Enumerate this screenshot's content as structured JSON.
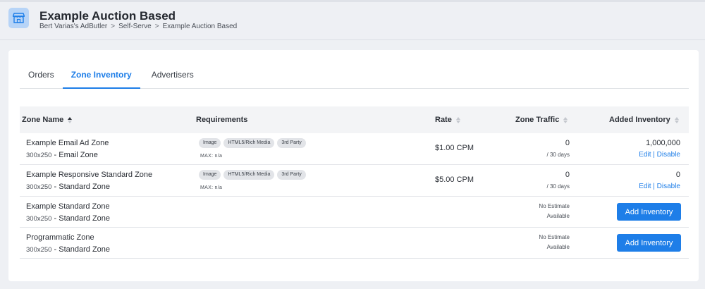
{
  "header": {
    "title": "Example Auction Based",
    "breadcrumb": [
      "Bert Varias's AdButler",
      "Self-Serve",
      "Example Auction Based"
    ],
    "breadcrumb_sep": ">"
  },
  "tabs": [
    {
      "label": "Orders",
      "active": false
    },
    {
      "label": "Zone Inventory",
      "active": true
    },
    {
      "label": "Advertisers",
      "active": false
    }
  ],
  "table": {
    "columns": [
      "Zone Name",
      "Requirements",
      "Rate",
      "Zone Traffic",
      "Added Inventory"
    ],
    "rows": [
      {
        "name": "Example Email Ad Zone",
        "size": "300x250",
        "type": "Email Zone",
        "badges": [
          "Image",
          "HTML5/Rich Media",
          "3rd Party"
        ],
        "max": "MAX: n/a",
        "rate": "$1.00 CPM",
        "traffic": "0",
        "traffic_period": "/ 30 days",
        "added": "1,000,000",
        "edit": "Edit",
        "pipe": "|",
        "disable": "Disable"
      },
      {
        "name": "Example Responsive Standard Zone",
        "size": "300x250",
        "type": "Standard Zone",
        "badges": [
          "Image",
          "HTML5/Rich Media",
          "3rd Party"
        ],
        "max": "MAX: n/a",
        "rate": "$5.00 CPM",
        "traffic": "0",
        "traffic_period": "/ 30 days",
        "added": "0",
        "edit": "Edit",
        "pipe": "|",
        "disable": "Disable"
      },
      {
        "name": "Example Standard Zone",
        "size": "300x250",
        "type": "Standard Zone",
        "estimate": [
          "No Estimate",
          "Available"
        ],
        "button": "Add Inventory"
      },
      {
        "name": "Programmatic Zone",
        "size": "300x250",
        "type": "Standard Zone",
        "estimate": [
          "No Estimate",
          "Available"
        ],
        "button": "Add Inventory"
      }
    ]
  },
  "dash": "-",
  "colors": {
    "accent": "#1e7ee8",
    "icon_bg": "#b7d4f7"
  },
  "icons": {
    "header": "storefront-icon",
    "sort": "sort-icon"
  }
}
